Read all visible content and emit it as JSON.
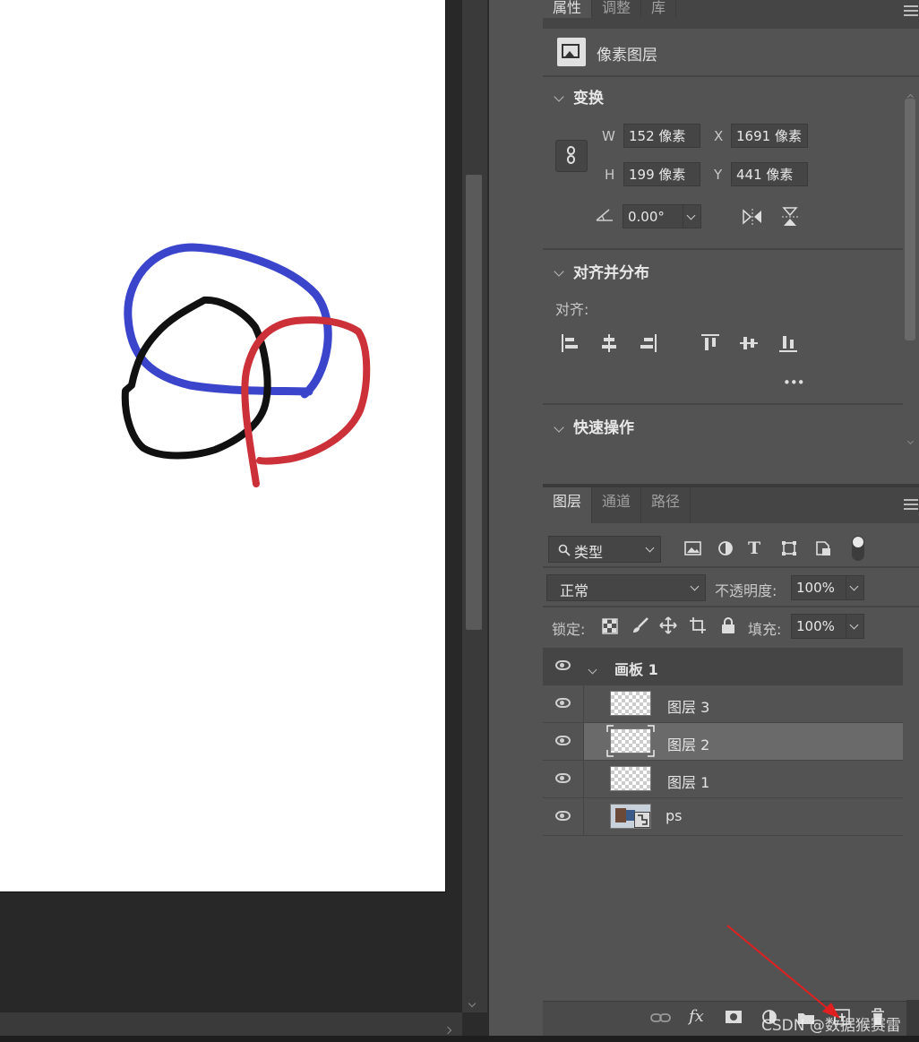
{
  "properties_panel": {
    "tabs": [
      "属性",
      "调整",
      "库"
    ],
    "layer_type": "像素图层",
    "transform": {
      "title": "变换",
      "w_label": "W",
      "w_value": "152 像素",
      "x_label": "X",
      "x_value": "1691 像素",
      "h_label": "H",
      "h_value": "199 像素",
      "y_label": "Y",
      "y_value": "441 像素",
      "angle_value": "0.00°"
    },
    "align": {
      "title": "对齐并分布",
      "align_label": "对齐:",
      "more": "•••"
    },
    "quick_actions": {
      "title": "快速操作"
    }
  },
  "layers_panel": {
    "tabs": [
      "图层",
      "通道",
      "路径"
    ],
    "filter_kind": "类型",
    "blend_mode": "正常",
    "opacity_label": "不透明度:",
    "opacity_value": "100%",
    "lock_label": "锁定:",
    "fill_label": "填充:",
    "fill_value": "100%",
    "group_name": "画板 1",
    "layers": [
      {
        "name": "图层 3"
      },
      {
        "name": "图层 2"
      },
      {
        "name": "图层 1"
      },
      {
        "name": "ps"
      }
    ],
    "footer_fx": "fx"
  },
  "watermark": "CSDN @数据猴赛雷",
  "colors": {
    "stroke_blue": "#3b45cc",
    "stroke_red": "#cc3038",
    "stroke_black": "#111111",
    "arrow_red": "#e02020",
    "panel_bg": "#535353"
  }
}
